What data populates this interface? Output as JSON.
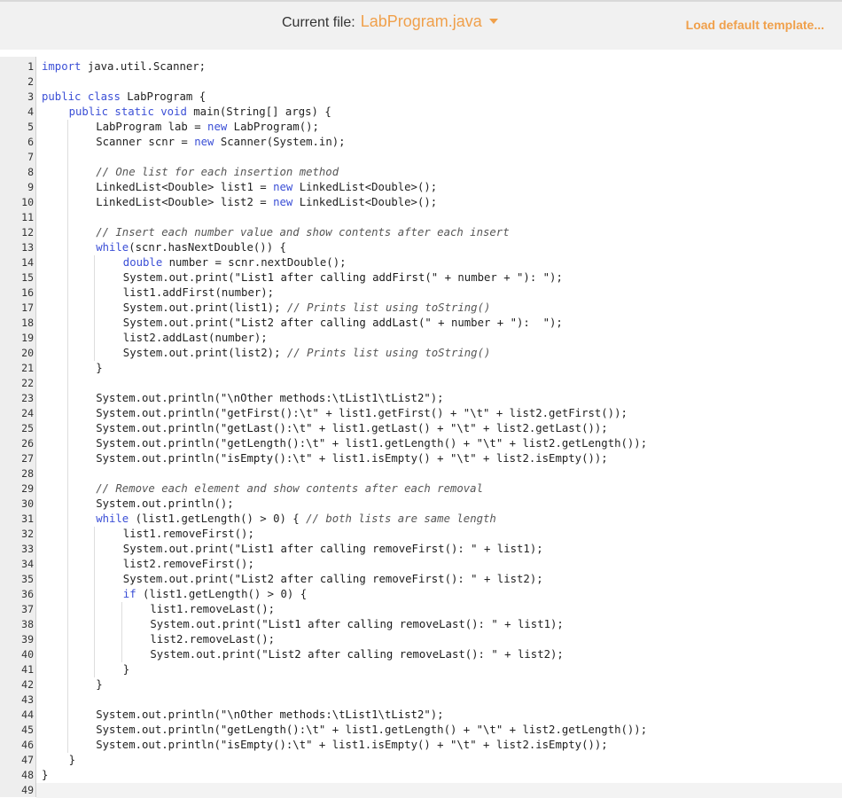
{
  "header": {
    "current_file_label": "Current file:",
    "file_name": "LabProgram.java",
    "load_default_label": "Load default template...",
    "accent_color": "#f0a04b"
  },
  "editor": {
    "lines": [
      {
        "n": "1",
        "indent": 0,
        "code": "import java.util.Scanner;"
      },
      {
        "n": "2",
        "indent": 0,
        "code": ""
      },
      {
        "n": "3",
        "indent": 0,
        "code": "public class LabProgram {"
      },
      {
        "n": "4",
        "indent": 1,
        "code": "public static void main(String[] args) {"
      },
      {
        "n": "5",
        "indent": 2,
        "code": "LabProgram lab = new LabProgram();"
      },
      {
        "n": "6",
        "indent": 2,
        "code": "Scanner scnr = new Scanner(System.in);"
      },
      {
        "n": "7",
        "indent": 2,
        "code": ""
      },
      {
        "n": "8",
        "indent": 2,
        "code": "// One list for each insertion method"
      },
      {
        "n": "9",
        "indent": 2,
        "code": "LinkedList<Double> list1 = new LinkedList<Double>();"
      },
      {
        "n": "10",
        "indent": 2,
        "code": "LinkedList<Double> list2 = new LinkedList<Double>();"
      },
      {
        "n": "11",
        "indent": 2,
        "code": ""
      },
      {
        "n": "12",
        "indent": 2,
        "code": "// Insert each number value and show contents after each insert"
      },
      {
        "n": "13",
        "indent": 2,
        "code": "while(scnr.hasNextDouble()) {"
      },
      {
        "n": "14",
        "indent": 3,
        "code": "double number = scnr.nextDouble();"
      },
      {
        "n": "15",
        "indent": 3,
        "code": "System.out.print(\"List1 after calling addFirst(\" + number + \"): \");"
      },
      {
        "n": "16",
        "indent": 3,
        "code": "list1.addFirst(number);"
      },
      {
        "n": "17",
        "indent": 3,
        "code": "System.out.print(list1); // Prints list using toString()"
      },
      {
        "n": "18",
        "indent": 3,
        "code": "System.out.print(\"List2 after calling addLast(\" + number + \"):  \");"
      },
      {
        "n": "19",
        "indent": 3,
        "code": "list2.addLast(number);"
      },
      {
        "n": "20",
        "indent": 3,
        "code": "System.out.print(list2); // Prints list using toString()"
      },
      {
        "n": "21",
        "indent": 2,
        "code": "}"
      },
      {
        "n": "22",
        "indent": 2,
        "code": ""
      },
      {
        "n": "23",
        "indent": 2,
        "code": "System.out.println(\"\\nOther methods:\\tList1\\tList2\");"
      },
      {
        "n": "24",
        "indent": 2,
        "code": "System.out.println(\"getFirst():\\t\" + list1.getFirst() + \"\\t\" + list2.getFirst());"
      },
      {
        "n": "25",
        "indent": 2,
        "code": "System.out.println(\"getLast():\\t\" + list1.getLast() + \"\\t\" + list2.getLast());"
      },
      {
        "n": "26",
        "indent": 2,
        "code": "System.out.println(\"getLength():\\t\" + list1.getLength() + \"\\t\" + list2.getLength());"
      },
      {
        "n": "27",
        "indent": 2,
        "code": "System.out.println(\"isEmpty():\\t\" + list1.isEmpty() + \"\\t\" + list2.isEmpty());"
      },
      {
        "n": "28",
        "indent": 2,
        "code": ""
      },
      {
        "n": "29",
        "indent": 2,
        "code": "// Remove each element and show contents after each removal"
      },
      {
        "n": "30",
        "indent": 2,
        "code": "System.out.println();"
      },
      {
        "n": "31",
        "indent": 2,
        "code": "while (list1.getLength() > 0) { // both lists are same length"
      },
      {
        "n": "32",
        "indent": 3,
        "code": "list1.removeFirst();"
      },
      {
        "n": "33",
        "indent": 3,
        "code": "System.out.print(\"List1 after calling removeFirst(): \" + list1);"
      },
      {
        "n": "34",
        "indent": 3,
        "code": "list2.removeFirst();"
      },
      {
        "n": "35",
        "indent": 3,
        "code": "System.out.print(\"List2 after calling removeFirst(): \" + list2);"
      },
      {
        "n": "36",
        "indent": 3,
        "code": "if (list1.getLength() > 0) {"
      },
      {
        "n": "37",
        "indent": 4,
        "code": "list1.removeLast();"
      },
      {
        "n": "38",
        "indent": 4,
        "code": "System.out.print(\"List1 after calling removeLast(): \" + list1);"
      },
      {
        "n": "39",
        "indent": 4,
        "code": "list2.removeLast();"
      },
      {
        "n": "40",
        "indent": 4,
        "code": "System.out.print(\"List2 after calling removeLast(): \" + list2);"
      },
      {
        "n": "41",
        "indent": 3,
        "code": "}"
      },
      {
        "n": "42",
        "indent": 2,
        "code": "}"
      },
      {
        "n": "43",
        "indent": 2,
        "code": ""
      },
      {
        "n": "44",
        "indent": 2,
        "code": "System.out.println(\"\\nOther methods:\\tList1\\tList2\");"
      },
      {
        "n": "45",
        "indent": 2,
        "code": "System.out.println(\"getLength():\\t\" + list1.getLength() + \"\\t\" + list2.getLength());"
      },
      {
        "n": "46",
        "indent": 2,
        "code": "System.out.println(\"isEmpty():\\t\" + list1.isEmpty() + \"\\t\" + list2.isEmpty());"
      },
      {
        "n": "47",
        "indent": 1,
        "code": "}"
      },
      {
        "n": "48",
        "indent": 0,
        "code": "}"
      },
      {
        "n": "49",
        "indent": 0,
        "code": ""
      }
    ]
  }
}
